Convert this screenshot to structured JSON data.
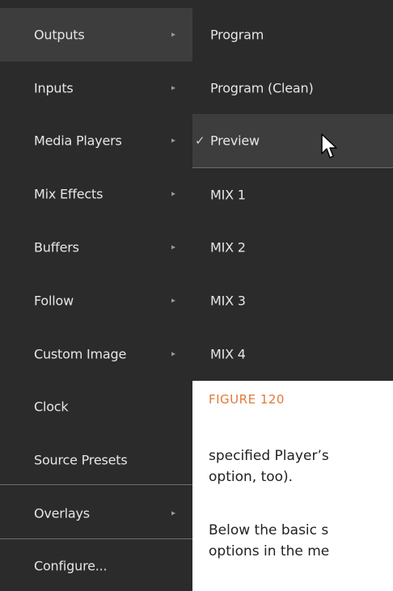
{
  "menu": {
    "items": [
      {
        "label": "Outputs",
        "submenu": true
      },
      {
        "label": "Inputs",
        "submenu": true
      },
      {
        "label": "Media Players",
        "submenu": true
      },
      {
        "label": "Mix Effects",
        "submenu": true
      },
      {
        "label": "Buffers",
        "submenu": true
      },
      {
        "label": "Follow",
        "submenu": true
      },
      {
        "label": "Custom Image",
        "submenu": true
      },
      {
        "label": "Clock",
        "submenu": false
      },
      {
        "label": "Source Presets",
        "submenu": false
      },
      {
        "label": "Overlays",
        "submenu": true
      },
      {
        "label": "Configure...",
        "submenu": false
      }
    ],
    "arrow_glyph": "▸"
  },
  "submenu": {
    "items": [
      {
        "label": "Program"
      },
      {
        "label": "Program (Clean)"
      },
      {
        "label": "Preview",
        "checked": true
      },
      {
        "label": "MIX 1"
      },
      {
        "label": "MIX 2"
      },
      {
        "label": "MIX 3"
      },
      {
        "label": "MIX 4"
      }
    ],
    "check_glyph": "✓"
  },
  "document": {
    "figure_label": "FIGURE 120",
    "paragraph1_line1": "specified Player’s",
    "paragraph1_line2": "option, too).",
    "paragraph2_line1": "Below the basic s",
    "paragraph2_line2": "options in the me"
  },
  "colors": {
    "menu_bg": "#2b2b2b",
    "menu_active_bg": "#3d3d3d",
    "menu_text": "#e6e6e6",
    "accent_figure": "#e07a3a"
  }
}
